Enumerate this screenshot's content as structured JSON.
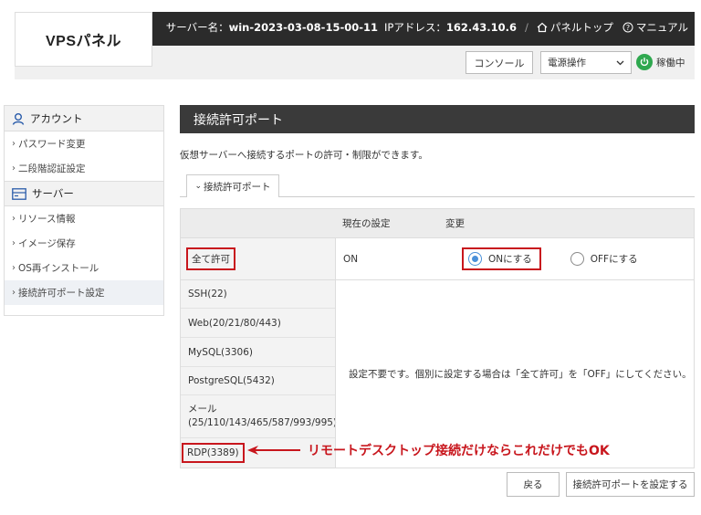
{
  "header": {
    "logo": "VPSパネル",
    "server_name_label": "サーバー名：",
    "server_name": "win-2023-03-08-15-00-11",
    "ip_label": "IPアドレス：",
    "ip": "162.43.10.6",
    "separator": "/",
    "panel_top": "パネルトップ",
    "manual": "マニュアル"
  },
  "toolbar": {
    "console": "コンソール",
    "power_select": "電源操作",
    "status": "稼働中",
    "status_color": "#2fa84f"
  },
  "sidebar": {
    "account_heading": "アカウント",
    "account_items": [
      {
        "label": "パスワード変更"
      },
      {
        "label": "二段階認証設定"
      }
    ],
    "server_heading": "サーバー",
    "server_items": [
      {
        "label": "リソース情報"
      },
      {
        "label": "イメージ保存"
      },
      {
        "label": "OS再インストール"
      },
      {
        "label": "接続許可ポート設定"
      }
    ]
  },
  "main": {
    "title": "接続許可ポート",
    "description": "仮想サーバーへ接続するポートの許可・制限ができます。",
    "tab": "接続許可ポート",
    "table": {
      "col_current": "現在の設定",
      "col_change": "変更",
      "all_label": "全て許可",
      "all_value": "ON",
      "opt_on": "ONにする",
      "opt_off": "OFFにする",
      "selected": "ON",
      "ports": [
        {
          "label": "SSH(22)"
        },
        {
          "label": "Web(20/21/80/443)"
        },
        {
          "label": "MySQL(3306)"
        },
        {
          "label": "PostgreSQL(5432)"
        },
        {
          "label": "メール",
          "sub": "(25/110/143/465/587/993/995)"
        },
        {
          "label": "RDP(3389)"
        }
      ],
      "note": "設定不要です。個別に設定する場合は「全て許可」を「OFF」にしてください。"
    },
    "annotation": "リモートデスクトップ接続だけならこれだけでもOK",
    "annotation_color": "#c8161d",
    "back_button": "戻る",
    "submit_button": "接続許可ポートを設定する"
  }
}
